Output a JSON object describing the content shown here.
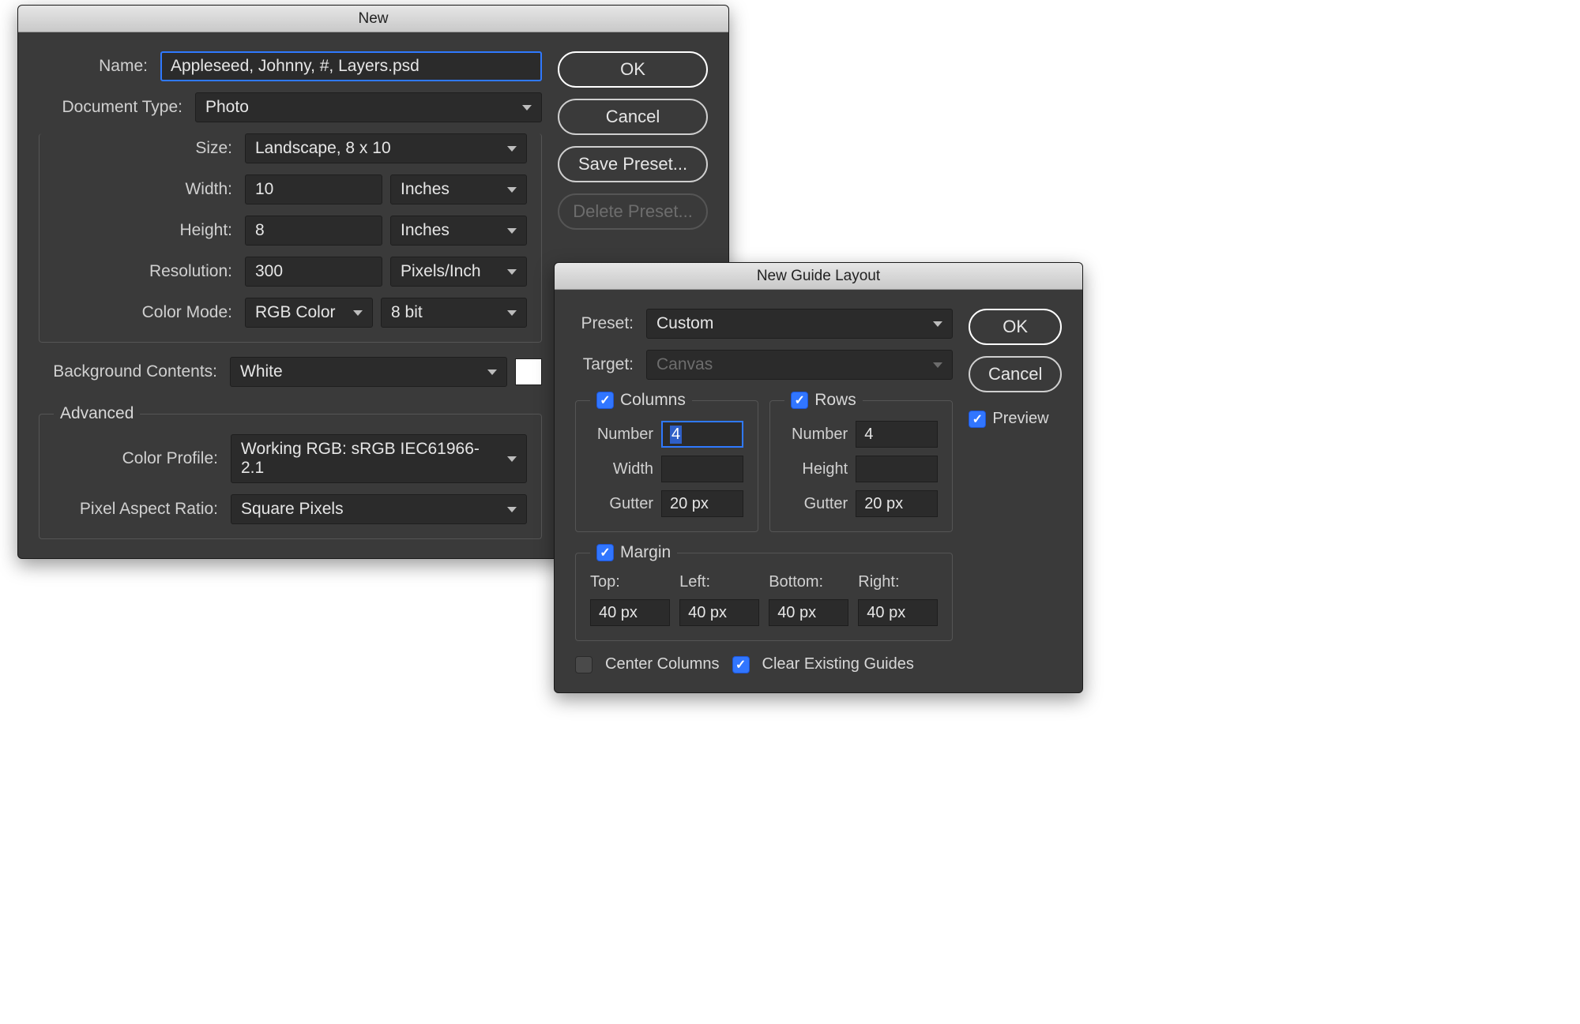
{
  "dialog1": {
    "title": "New",
    "name_label": "Name:",
    "name_value": "Appleseed, Johnny, #, Layers.psd",
    "doctype_label": "Document Type:",
    "doctype_value": "Photo",
    "size_label": "Size:",
    "size_value": "Landscape, 8 x 10",
    "width_label": "Width:",
    "width_value": "10",
    "width_unit": "Inches",
    "height_label": "Height:",
    "height_value": "8",
    "height_unit": "Inches",
    "resolution_label": "Resolution:",
    "resolution_value": "300",
    "resolution_unit": "Pixels/Inch",
    "colormode_label": "Color Mode:",
    "colormode_value": "RGB Color",
    "bitdepth_value": "8 bit",
    "bgcontents_label": "Background Contents:",
    "bgcontents_value": "White",
    "bg_color": "#ffffff",
    "advanced_label": "Advanced",
    "colorprofile_label": "Color Profile:",
    "colorprofile_value": "Working RGB:  sRGB IEC61966-2.1",
    "pixelaspect_label": "Pixel Aspect Ratio:",
    "pixelaspect_value": "Square Pixels",
    "ok": "OK",
    "cancel": "Cancel",
    "save_preset": "Save Preset...",
    "delete_preset": "Delete Preset..."
  },
  "dialog2": {
    "title": "New Guide Layout",
    "preset_label": "Preset:",
    "preset_value": "Custom",
    "target_label": "Target:",
    "target_value": "Canvas",
    "columns": {
      "checked": true,
      "legend": "Columns",
      "number_label": "Number",
      "number_value": "4",
      "width_label": "Width",
      "width_value": "",
      "gutter_label": "Gutter",
      "gutter_value": "20 px"
    },
    "rows": {
      "checked": true,
      "legend": "Rows",
      "number_label": "Number",
      "number_value": "4",
      "height_label": "Height",
      "height_value": "",
      "gutter_label": "Gutter",
      "gutter_value": "20 px"
    },
    "margin": {
      "checked": true,
      "legend": "Margin",
      "top_label": "Top:",
      "top_value": "40 px",
      "left_label": "Left:",
      "left_value": "40 px",
      "bottom_label": "Bottom:",
      "bottom_value": "40 px",
      "right_label": "Right:",
      "right_value": "40 px"
    },
    "center_columns_checked": false,
    "center_columns_label": "Center Columns",
    "clear_guides_checked": true,
    "clear_guides_label": "Clear Existing Guides",
    "ok": "OK",
    "cancel": "Cancel",
    "preview_checked": true,
    "preview_label": "Preview"
  }
}
